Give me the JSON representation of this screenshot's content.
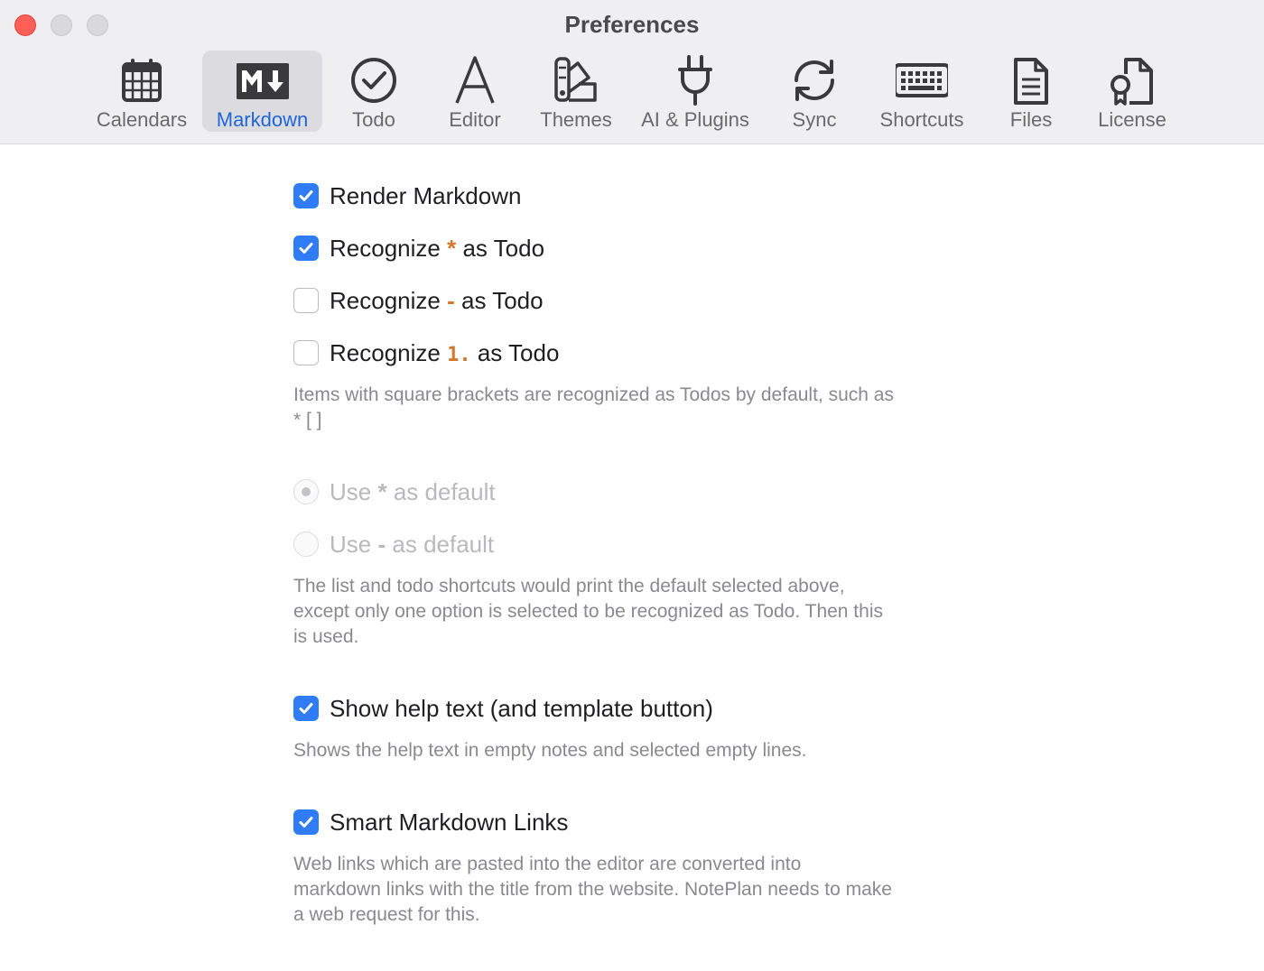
{
  "window": {
    "title": "Preferences"
  },
  "toolbar": {
    "tabs": [
      {
        "label": "Calendars",
        "icon": "calendar-icon"
      },
      {
        "label": "Markdown",
        "icon": "markdown-icon",
        "active": true
      },
      {
        "label": "Todo",
        "icon": "check-circle-icon"
      },
      {
        "label": "Editor",
        "icon": "letter-a-icon"
      },
      {
        "label": "Themes",
        "icon": "swatch-icon"
      },
      {
        "label": "AI & Plugins",
        "icon": "plug-icon"
      },
      {
        "label": "Sync",
        "icon": "sync-icon"
      },
      {
        "label": "Shortcuts",
        "icon": "keyboard-icon"
      },
      {
        "label": "Files",
        "icon": "document-icon"
      },
      {
        "label": "License",
        "icon": "certificate-icon"
      }
    ]
  },
  "markdown": {
    "render": {
      "label": "Render Markdown",
      "checked": true
    },
    "recognize_star": {
      "prefix": "Recognize",
      "marker": "*",
      "suffix": "as Todo",
      "checked": true
    },
    "recognize_dash": {
      "prefix": "Recognize",
      "marker": "-",
      "suffix": "as Todo",
      "checked": false
    },
    "recognize_number": {
      "prefix": "Recognize",
      "marker": "1.",
      "suffix": "as Todo",
      "checked": false
    },
    "recognize_help_line1": "Items with square brackets are recognized as Todos by default, such as",
    "recognize_help_line2": "* [ ]",
    "default_star": {
      "prefix": "Use",
      "marker": "*",
      "suffix": "as default",
      "selected": true,
      "disabled": true
    },
    "default_dash": {
      "prefix": "Use",
      "marker": "-",
      "suffix": "as default",
      "selected": false,
      "disabled": true
    },
    "default_help_line1": "The list and todo shortcuts would print the default selected above,",
    "default_help_line2": "except only one option is selected to be recognized as Todo. Then this",
    "default_help_line3": "is used.",
    "show_help": {
      "label": "Show help text (and template button)",
      "checked": true
    },
    "show_help_desc": "Shows the help text in empty notes and selected empty lines.",
    "smart_links": {
      "label": "Smart Markdown Links",
      "checked": true
    },
    "smart_links_line1": "Web links which are pasted into the editor are converted into",
    "smart_links_line2": "markdown links with the title from the website. NotePlan needs to make",
    "smart_links_line3": "a web request for this."
  },
  "colors": {
    "accent": "#2f7cf6",
    "marker": "#d2782a",
    "active_tab_text": "#1f66d6",
    "help_text": "#8a8a8e"
  }
}
